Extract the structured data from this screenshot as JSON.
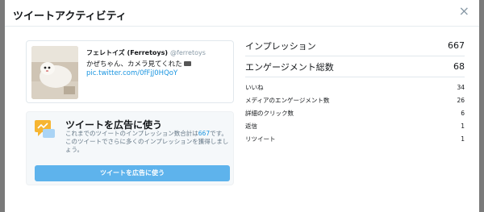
{
  "modal": {
    "title": "ツイートアクティビティ",
    "close_label": "×"
  },
  "tweet": {
    "author_name": "フェレトイズ (Ferretoys)",
    "author_handle": "@ferretoys",
    "text": "かぜちゃん、カメラ見てくれた",
    "link": "pic.twitter.com/0fFjJ0HQoY"
  },
  "promote": {
    "title": "ツイートを広告に使う",
    "desc_prefix": "これまでのツイートのインプレッション数合計は",
    "desc_count": "667",
    "desc_suffix": "です。",
    "desc_line2": "このツイートでさらに多くのインプレッションを獲得しましょう。",
    "button_label": "ツイートを広告に使う"
  },
  "stats": {
    "impressions": {
      "label": "インプレッション",
      "value": "667"
    },
    "engagements": {
      "label": "エンゲージメント総数",
      "value": "68"
    },
    "details": [
      {
        "label": "いいね",
        "value": "34"
      },
      {
        "label": "メディアのエンゲージメント数",
        "value": "26"
      },
      {
        "label": "詳細のクリック数",
        "value": "6"
      },
      {
        "label": "返信",
        "value": "1"
      },
      {
        "label": "リツイート",
        "value": "1"
      }
    ]
  },
  "colors": {
    "link": "#1b95e0",
    "button": "#5eb3ec",
    "promote_bg": "#f5f8fa"
  }
}
